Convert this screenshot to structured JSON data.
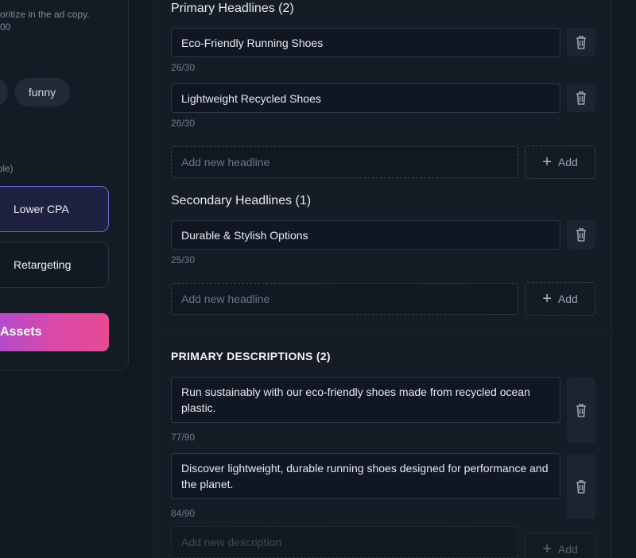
{
  "left": {
    "hint_line1": "oritize in the ad copy.",
    "hint_line2": "00",
    "chips": [
      "",
      "funny"
    ],
    "multi_hint": "iple)",
    "goals": [
      {
        "label": "Lower CPA",
        "selected": true,
        "icon": "chart-icon"
      },
      {
        "label": "Retargeting",
        "selected": false,
        "icon": "retarget-icon"
      }
    ],
    "generate_button": "Assets"
  },
  "primary_headlines": {
    "title": "Primary Headlines (2)",
    "items": [
      {
        "text": "Eco-Friendly Running Shoes",
        "count": "26/30"
      },
      {
        "text": "Lightweight Recycled Shoes",
        "count": "26/30"
      }
    ],
    "new_placeholder": "Add new headline",
    "add_label": "Add"
  },
  "secondary_headlines": {
    "title": "Secondary Headlines (1)",
    "items": [
      {
        "text": "Durable & Stylish Options",
        "count": "25/30"
      }
    ],
    "new_placeholder": "Add new headline",
    "add_label": "Add"
  },
  "primary_descriptions": {
    "title": "PRIMARY DESCRIPTIONS (2)",
    "items": [
      {
        "text": "Run sustainably with our eco-friendly shoes made from recycled ocean plastic.",
        "count": "77/90"
      },
      {
        "text": "Discover lightweight, durable running shoes designed for performance and the planet.",
        "count": "84/90"
      }
    ],
    "new_placeholder": "Add new description",
    "add_label": "Add"
  },
  "icons": {
    "delete": "trash-icon",
    "add": "plus-icon"
  },
  "colors": {
    "accent": "#6d69d8",
    "gradient_start": "#9b4ce0",
    "gradient_end": "#e84a94"
  }
}
